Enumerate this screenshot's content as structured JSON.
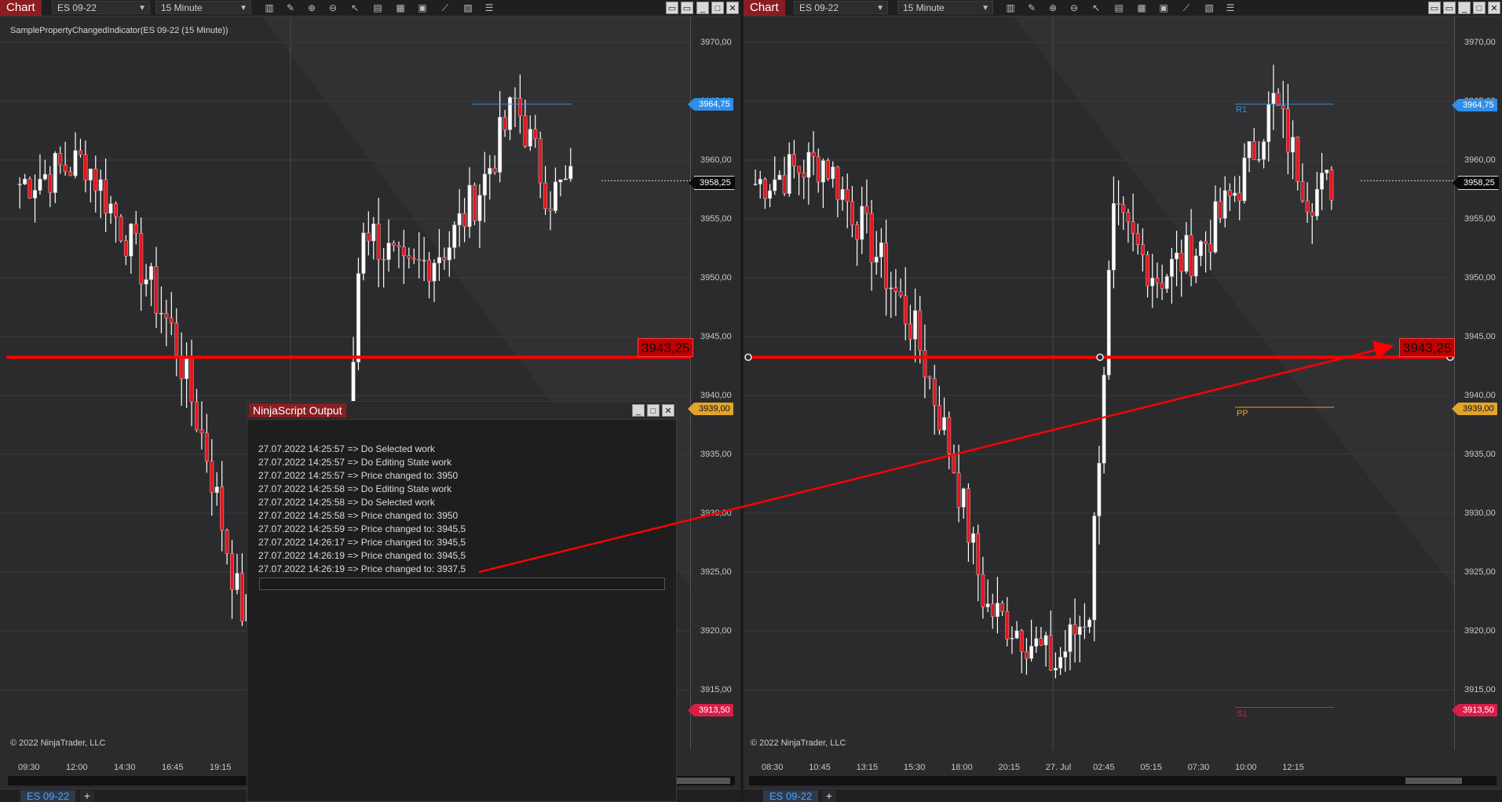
{
  "left_window": {
    "tab": "Chart",
    "instrument": "ES 09-22",
    "interval": "15 Minute",
    "indicator_title": "SamplePropertyChangedIndicator(ES 09-22 (15 Minute))",
    "copyright": "© 2022 NinjaTrader, LLC",
    "time_labels": [
      "09:30",
      "12:00",
      "14:30",
      "16:45",
      "19:15"
    ],
    "bottom_tab": "ES 09-22",
    "add_tab": "+"
  },
  "right_window": {
    "tab": "Chart",
    "instrument": "ES 09-22",
    "interval": "15 Minute",
    "copyright": "© 2022 NinjaTrader, LLC",
    "time_labels": [
      "08:30",
      "10:45",
      "13:15",
      "15:30",
      "18:00",
      "20:15",
      "27. Jul",
      "02:45",
      "05:15",
      "07:30",
      "10:00",
      "12:15"
    ],
    "bottom_tab": "ES 09-22",
    "add_tab": "+",
    "pivots": {
      "r1": "R1",
      "pp": "PP",
      "s1": "S1"
    }
  },
  "price_axis": [
    "3970,00",
    "3965,00",
    "3960,00",
    "3955,00",
    "3950,00",
    "3945,00",
    "3940,00",
    "3935,00",
    "3930,00",
    "3925,00",
    "3920,00",
    "3915,00"
  ],
  "badges": {
    "r1": "3964,75",
    "last": "3958,25",
    "pp": "3939,00",
    "s1": "3913,50",
    "drawn_line": "3943,25"
  },
  "output_window": {
    "title": "NinjaScript Output",
    "lines": [
      "27.07.2022 14:25:57 => Do Selected work",
      "27.07.2022 14:25:57 => Do Editing State work",
      "27.07.2022 14:25:57 => Price changed to: 3950",
      "27.07.2022 14:25:58 => Do Editing State work",
      "27.07.2022 14:25:58 => Do Selected work",
      "27.07.2022 14:25:58 => Price changed to: 3950",
      "27.07.2022 14:25:59 => Price changed to: 3945,5",
      "27.07.2022 14:26:17 => Price changed to: 3945,5",
      "27.07.2022 14:26:19 => Price changed to: 3945,5",
      "27.07.2022 14:26:19 => Price changed to: 3937,5"
    ]
  },
  "colors": {
    "up_candle": "#ffffff",
    "down_candle": "#e8141d",
    "r1": "#2f8fe8",
    "pp": "#e2a52a",
    "s1": "#d71f49",
    "drawn_line": "#ff0000"
  },
  "icons": [
    "bar-chart-icon",
    "pencil-icon",
    "zoom-in-icon",
    "zoom-out-icon",
    "pointer-icon",
    "properties-icon",
    "data-box-icon",
    "strategy-icon",
    "indicator-icon",
    "list-icon"
  ]
}
